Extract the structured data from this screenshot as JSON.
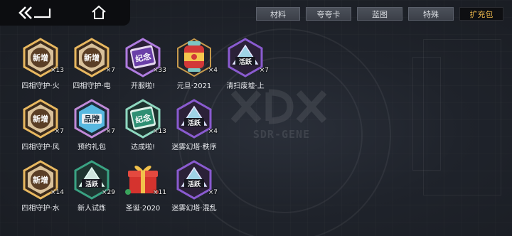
{
  "tabs": [
    {
      "label": "材料",
      "active": false
    },
    {
      "label": "夸夸卡",
      "active": false
    },
    {
      "label": "蓝图",
      "active": false
    },
    {
      "label": "特殊",
      "active": false
    },
    {
      "label": "扩充包",
      "active": true
    }
  ],
  "background": {
    "logo_text": "SDR-GENE"
  },
  "items": [
    {
      "name": "四相守护·火",
      "count": "×13",
      "badge": "新增",
      "style": "gold"
    },
    {
      "name": "四相守护·电",
      "count": "×7",
      "badge": "新增",
      "style": "gold"
    },
    {
      "name": "开服啦!",
      "count": "×33",
      "badge": "纪念",
      "style": "purple-book"
    },
    {
      "name": "元旦·2021",
      "count": "×4",
      "badge": "",
      "style": "red-lantern"
    },
    {
      "name": "清扫废墟·上",
      "count": "×7",
      "badge": "活跃",
      "style": "purple-tri"
    },
    {
      "name": "四相守护·风",
      "count": "×7",
      "badge": "新增",
      "style": "gold"
    },
    {
      "name": "预约礼包",
      "count": "×7",
      "badge": "品牌",
      "style": "blue"
    },
    {
      "name": "达成啦!",
      "count": "×13",
      "badge": "纪念",
      "style": "green-book"
    },
    {
      "name": "迷雾幻塔·秩序",
      "count": "×4",
      "badge": "活跃",
      "style": "purple-tri"
    },
    {
      "name": "四相守护·水",
      "count": "×14",
      "badge": "新增",
      "style": "gold"
    },
    {
      "name": "新人试炼",
      "count": "×29",
      "badge": "活跃",
      "style": "green-tri"
    },
    {
      "name": "圣诞·2020",
      "count": "×11",
      "badge": "",
      "style": "gift"
    },
    {
      "name": "迷雾幻塔·混乱",
      "count": "×7",
      "badge": "活跃",
      "style": "purple-tri"
    }
  ],
  "colors": {
    "active_tab_text": "#e5b24a",
    "gold": "#e8b860",
    "purple": "#8a5bd0",
    "blue": "#58b8e0",
    "green": "#3aa383",
    "red": "#d23838"
  }
}
